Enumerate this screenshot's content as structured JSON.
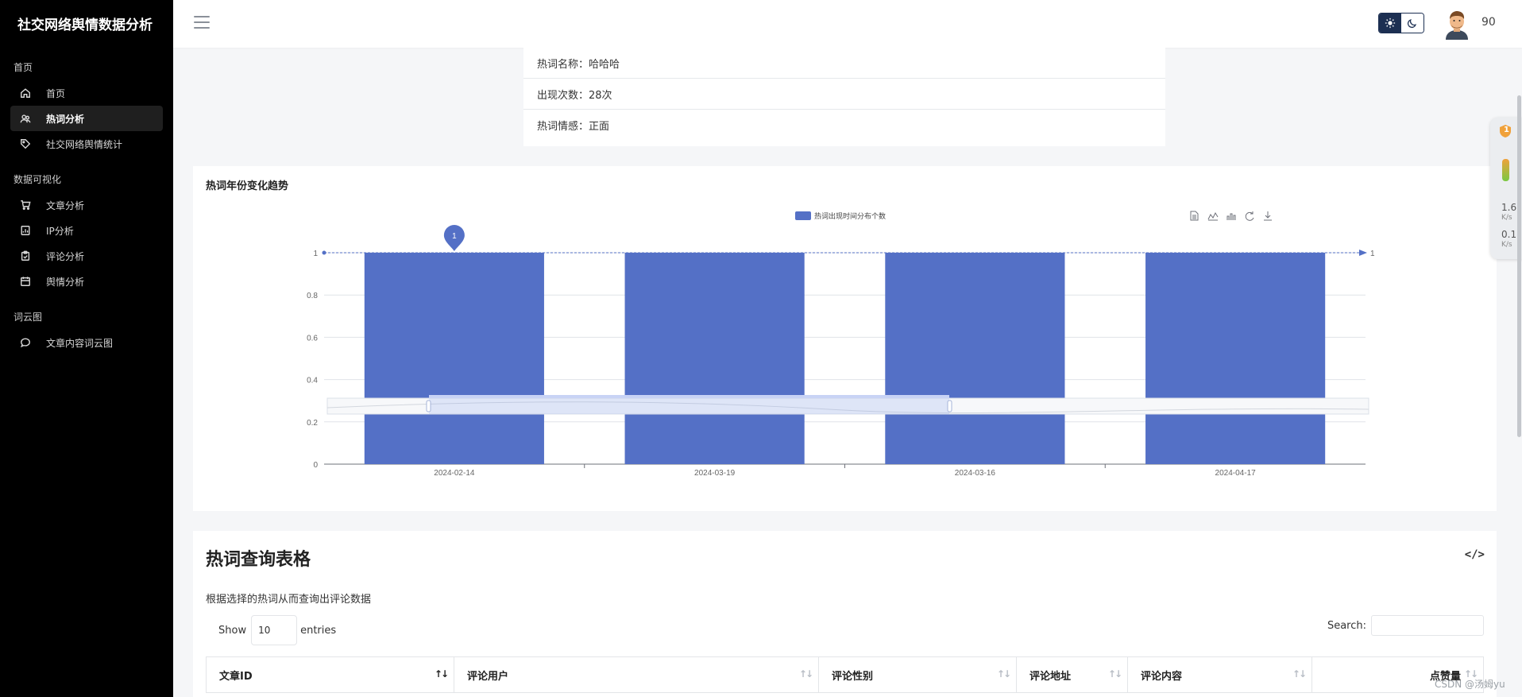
{
  "app": {
    "title": "社交网络舆情数据分析"
  },
  "sidebar": {
    "sections": [
      {
        "title": "首页",
        "items": [
          {
            "label": "首页",
            "icon": "home-icon"
          },
          {
            "label": "热词分析",
            "icon": "users-icon",
            "active": true
          },
          {
            "label": "社交网络舆情统计",
            "icon": "tag-icon"
          }
        ]
      },
      {
        "title": "数据可视化",
        "items": [
          {
            "label": "文章分析",
            "icon": "cart-icon"
          },
          {
            "label": "IP分析",
            "icon": "chart-file-icon"
          },
          {
            "label": "评论分析",
            "icon": "clipboard-icon"
          },
          {
            "label": "舆情分析",
            "icon": "calendar-icon"
          }
        ]
      },
      {
        "title": "词云图",
        "items": [
          {
            "label": "文章内容词云图",
            "icon": "message-icon"
          }
        ]
      }
    ]
  },
  "topbar": {
    "user_count": "90",
    "theme": {
      "selected": "light"
    }
  },
  "hot_word_info": {
    "rows": [
      "热词名称：哈哈哈",
      "出现次数：28次",
      "热词情感：正面"
    ]
  },
  "chart_card": {
    "title": "热词年份变化趋势",
    "toolbox_icons": [
      "data-view-icon",
      "line-switch-icon",
      "bar-switch-icon",
      "restore-icon",
      "save-image-icon"
    ]
  },
  "chart_data": {
    "type": "bar",
    "legend": "热词出现时间分布个数",
    "categories": [
      "2024-02-14",
      "2024-03-19",
      "2024-03-16",
      "2024-04-17"
    ],
    "series": [
      {
        "name": "热词出现时间分布个数",
        "values": [
          1,
          1,
          1,
          1
        ],
        "color": "#5470c6"
      }
    ],
    "ylim": [
      0,
      1
    ],
    "yticks": [
      "0",
      "0.2",
      "0.4",
      "0.6",
      "0.8",
      "1"
    ],
    "mark_point": {
      "label": "1",
      "category": "2024-02-14"
    },
    "mark_line": {
      "value": "1"
    },
    "grid": true,
    "legend_position": "top-center"
  },
  "table_card": {
    "title": "热词查询表格",
    "subtitle": "根据选择的热词从而查询出评论数据",
    "show_label": "Show",
    "entries_value": "10",
    "entries_label": "entries",
    "search_label": "Search:",
    "columns": [
      "文章ID",
      "评论用户",
      "评论性别",
      "评论地址",
      "评论内容",
      "点赞量"
    ]
  },
  "speed_widget": {
    "badge": "1",
    "up": "1.6",
    "up_unit": "K/s",
    "down": "0.1",
    "down_unit": "K/s"
  },
  "watermark": "CSDN @汤姆yu"
}
